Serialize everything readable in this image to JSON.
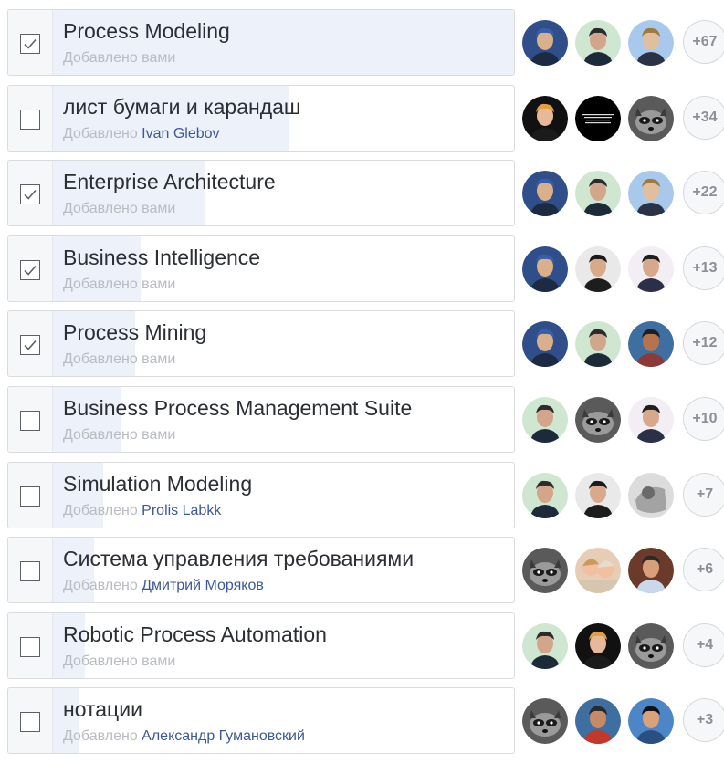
{
  "added_prefix": "Добавлено",
  "skills": [
    {
      "name": "Process Modeling",
      "added_by": "вами",
      "by_self": true,
      "checked": true,
      "endorsement_share": 1.0,
      "more": "+67",
      "avatars": [
        "man-suit-blue-bg-avatar",
        "man-green-bg-avatar",
        "man-light-blue-bg-avatar"
      ]
    },
    {
      "name": "лист бумаги и карандаш",
      "added_by": "Ivan Glebov",
      "by_self": false,
      "checked": false,
      "endorsement_share": 0.51,
      "more": "+34",
      "avatars": [
        "woman-orange-hair-avatar",
        "black-text-avatar",
        "raccoon-avatar"
      ]
    },
    {
      "name": "Enterprise Architecture",
      "added_by": "вами",
      "by_self": true,
      "checked": true,
      "endorsement_share": 0.33,
      "more": "+22",
      "avatars": [
        "man-suit-blue-bg-avatar",
        "man-green-bg-avatar",
        "man-light-blue-bg-avatar"
      ]
    },
    {
      "name": "Business Intelligence",
      "added_by": "вами",
      "by_self": true,
      "checked": true,
      "endorsement_share": 0.19,
      "more": "+13",
      "avatars": [
        "man-suit-blue-bg-avatar",
        "man-beret-avatar",
        "man-dark-suit-avatar"
      ]
    },
    {
      "name": "Process Mining",
      "added_by": "вами",
      "by_self": true,
      "checked": true,
      "endorsement_share": 0.18,
      "more": "+12",
      "avatars": [
        "man-suit-blue-bg-avatar",
        "man-green-bg-avatar",
        "man-outdoor-avatar"
      ]
    },
    {
      "name": "Business Process Management Suite",
      "added_by": "вами",
      "by_self": true,
      "checked": false,
      "endorsement_share": 0.15,
      "more": "+10",
      "avatars": [
        "man-green-bg-avatar",
        "raccoon-avatar",
        "man-dark-suit-avatar"
      ]
    },
    {
      "name": "Simulation Modeling",
      "added_by": "Prolis Labkk",
      "by_self": false,
      "checked": false,
      "endorsement_share": 0.11,
      "more": "+7",
      "avatars": [
        "man-green-bg-avatar",
        "man-beret-avatar",
        "grey-sketch-avatar"
      ]
    },
    {
      "name": "Система управления требованиями",
      "added_by": "Дмитрий Моряков",
      "by_self": false,
      "checked": false,
      "endorsement_share": 0.09,
      "more": "+6",
      "avatars": [
        "raccoon-avatar",
        "two-women-avatar",
        "man-red-shirt-avatar"
      ]
    },
    {
      "name": "Robotic Process Automation",
      "added_by": "вами",
      "by_self": true,
      "checked": false,
      "endorsement_share": 0.07,
      "more": "+4",
      "avatars": [
        "man-green-bg-avatar",
        "woman-orange-hair-avatar",
        "raccoon-avatar"
      ]
    },
    {
      "name": "нотации",
      "added_by": "Александр Гумановский",
      "by_self": false,
      "checked": false,
      "endorsement_share": 0.06,
      "more": "+3",
      "avatars": [
        "raccoon-avatar",
        "man-glasses-avatar",
        "man-sunglasses-blue-avatar"
      ]
    }
  ],
  "colors": {
    "accent_link": "#3b5998",
    "endorse_fill": "#edf1f9",
    "border": "#d9dbdf"
  }
}
